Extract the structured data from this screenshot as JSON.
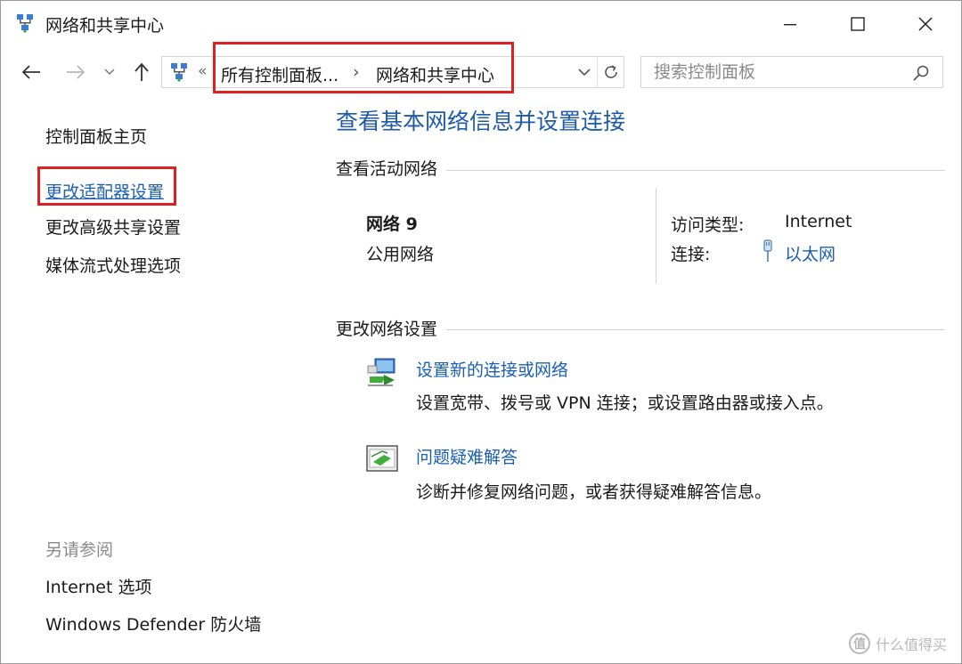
{
  "window": {
    "title": "网络和共享中心",
    "controls": {
      "minimize": "minimize",
      "maximize": "maximize",
      "close": "close"
    }
  },
  "address_bar": {
    "chevron": "«",
    "crumb_1": "所有控制面板...",
    "separator": "›",
    "crumb_2": "网络和共享中心"
  },
  "search": {
    "placeholder": "搜索控制面板"
  },
  "left_pane": {
    "home": "控制面板主页",
    "adapter": "更改适配器设置",
    "advanced": "更改高级共享设置",
    "media": "媒体流式处理选项",
    "see_also": "另请参阅",
    "internet_options": "Internet 选项",
    "defender": "Windows Defender 防火墙"
  },
  "main": {
    "title": "查看基本网络信息并设置连接",
    "active_networks_heading": "查看活动网络",
    "network": {
      "name": "网络 9",
      "category": "公用网络",
      "access_type_label": "访问类型:",
      "access_type_value": "Internet",
      "connections_label": "连接:",
      "connections_value": "以太网"
    },
    "change_settings_heading": "更改网络设置",
    "tasks": [
      {
        "link": "设置新的连接或网络",
        "desc": "设置宽带、拨号或 VPN 连接；或设置路由器或接入点。",
        "icon": "network-setup-icon"
      },
      {
        "link": "问题疑难解答",
        "desc": "诊断并修复网络问题，或者获得疑难解答信息。",
        "icon": "troubleshoot-icon"
      }
    ]
  },
  "watermark": {
    "text": "什么值得买",
    "logo": "值"
  },
  "colors": {
    "link": "#1a5fb4",
    "title": "#1e5aa8",
    "highlight_box": "#e02020"
  }
}
